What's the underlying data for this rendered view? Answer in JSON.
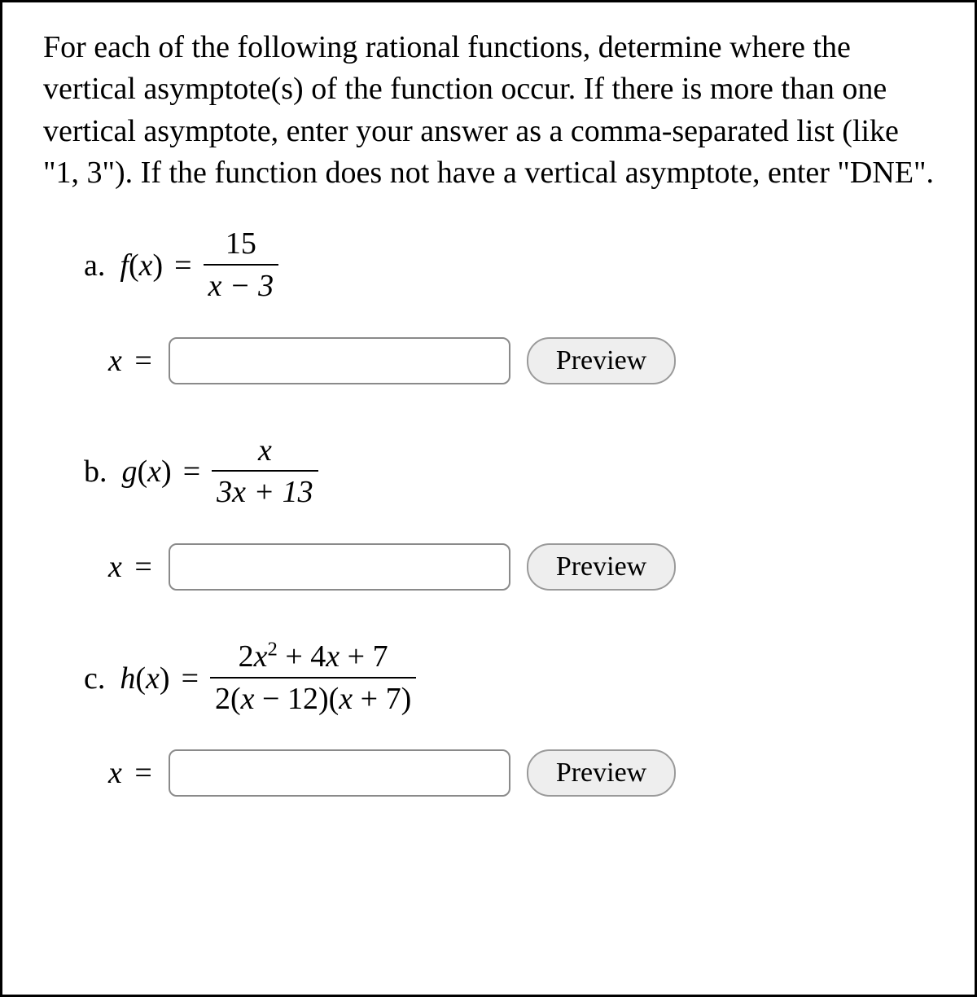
{
  "instructions": "For each of the following rational functions, determine where the vertical asymptote(s) of the function occur. If there is more than one vertical asymptote, enter your answer as a comma-separated list (like \"1, 3\"). If the function does not have a vertical asymptote, enter \"DNE\".",
  "problems": {
    "a": {
      "label": "a.",
      "func_name": "f",
      "numerator": "15",
      "denominator": "x − 3",
      "answer_prefix": "x =",
      "preview_label": "Preview",
      "input_value": ""
    },
    "b": {
      "label": "b.",
      "func_name": "g",
      "numerator": "x",
      "denominator": "3x + 13",
      "answer_prefix": "x =",
      "preview_label": "Preview",
      "input_value": ""
    },
    "c": {
      "label": "c.",
      "func_name": "h",
      "numerator": "2x² + 4x + 7",
      "denominator": "2(x − 12)(x + 7)",
      "answer_prefix": "x =",
      "preview_label": "Preview",
      "input_value": ""
    }
  }
}
